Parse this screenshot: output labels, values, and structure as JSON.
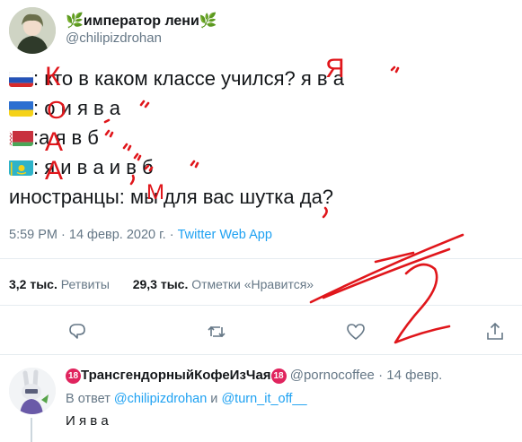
{
  "author": {
    "name": "император лени",
    "leaf_glyph": "🌿",
    "handle": "@chilipizdrohan"
  },
  "tweet": {
    "lines": [
      {
        "flag": "ru",
        "text": ": кто в каком классе учился? я в а"
      },
      {
        "flag": "ua",
        "text": ": о и я в а"
      },
      {
        "flag": "by",
        "text": ":а я в б"
      },
      {
        "flag": "kz",
        "text": ": я и в а и в б"
      },
      {
        "flag": null,
        "text": "иностранцы: мы для вас шутка да?"
      }
    ],
    "time": "5:59 PM",
    "sep1": " · ",
    "date": "14 февр. 2020 г.",
    "sep2": " · ",
    "app": "Twitter Web App"
  },
  "stats": {
    "retweets_count": "3,2 тыс.",
    "retweets_label": " Ретвиты",
    "likes_count": "29,3 тыс.",
    "likes_label": " Отметки «Нравится»"
  },
  "actions": [
    "reply-icon",
    "retweet-icon",
    "like-icon",
    "share-icon"
  ],
  "reply": {
    "badge": "18",
    "name": "ТрансгендорныйКофеИзЧая",
    "handle": "@pornocoffee",
    "sep": " · ",
    "date": "14 февр.",
    "replying_prefix": "В ответ ",
    "mention1": "@chilipizdrohan",
    "and": " и ",
    "mention2": "@turn_it_off__",
    "text": "И я в а"
  },
  "scribbles": {
    "color": "#e0161b",
    "letters": [
      "К",
      "О",
      "А",
      "А",
      "Я",
      "М"
    ],
    "number": "2"
  },
  "colors": {
    "text": "#14171a",
    "secondary": "#657786",
    "link": "#1da1f2",
    "divider": "#e6ecf0"
  }
}
